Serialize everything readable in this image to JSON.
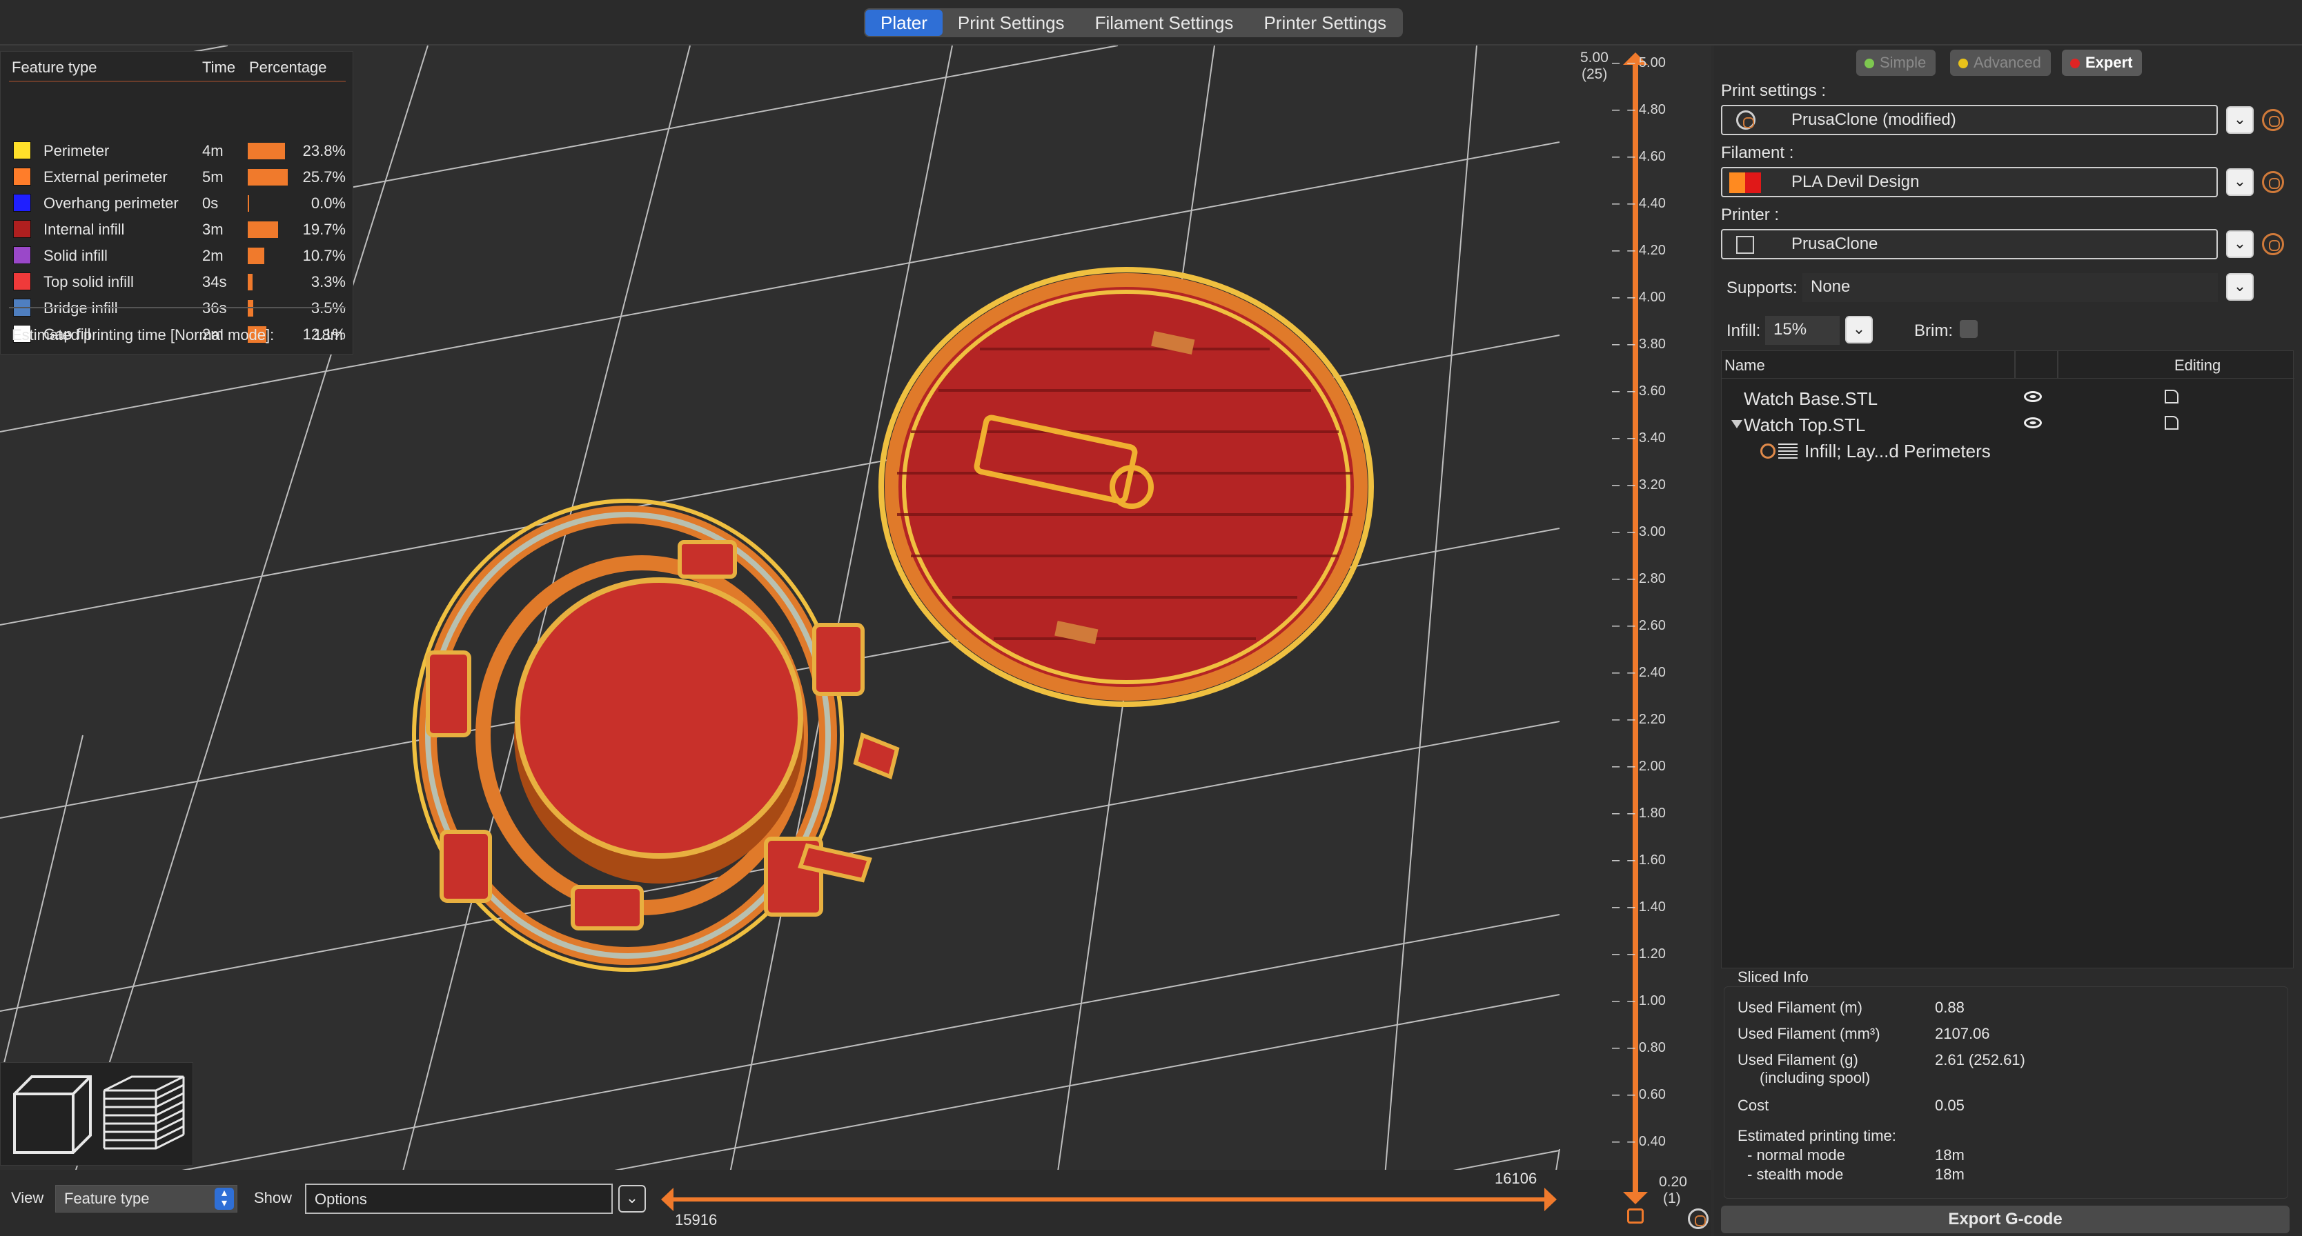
{
  "tabs": [
    "Plater",
    "Print Settings",
    "Filament Settings",
    "Printer Settings"
  ],
  "legend": {
    "headers": {
      "feature": "Feature type",
      "time": "Time",
      "percentage": "Percentage"
    },
    "rows": [
      {
        "name": "Perimeter",
        "time": "4m",
        "pct": "23.8%",
        "value": 23.8,
        "color": "#ffe02a"
      },
      {
        "name": "External perimeter",
        "time": "5m",
        "pct": "25.7%",
        "value": 25.7,
        "color": "#ff7d2a"
      },
      {
        "name": "Overhang perimeter",
        "time": "0s",
        "pct": "0.0%",
        "value": 0.0,
        "color": "#1f1fff"
      },
      {
        "name": "Internal infill",
        "time": "3m",
        "pct": "19.7%",
        "value": 19.7,
        "color": "#b01f1f"
      },
      {
        "name": "Solid infill",
        "time": "2m",
        "pct": "10.7%",
        "value": 10.7,
        "color": "#9a48c9"
      },
      {
        "name": "Top solid infill",
        "time": "34s",
        "pct": "3.3%",
        "value": 3.3,
        "color": "#f03a3a"
      },
      {
        "name": "Bridge infill",
        "time": "36s",
        "pct": "3.5%",
        "value": 3.5,
        "color": "#4f7fc0"
      },
      {
        "name": "Gap fill",
        "time": "2m",
        "pct": "12.1%",
        "value": 12.1,
        "color": "#ffffff"
      }
    ],
    "estimated_label": "Estimated printing time [Normal mode]:",
    "estimated_value": "18m"
  },
  "bottom": {
    "view_label": "View",
    "view_value": "Feature type",
    "show_label": "Show",
    "show_value": "Options",
    "hslider_left": "15916",
    "hslider_right": "16106"
  },
  "vslider": {
    "top_value": "5.00",
    "top_layer": "(25)",
    "bottom_value": "0.20",
    "bottom_layer": "(1)",
    "ticks": [
      "5.00",
      "4.80",
      "4.60",
      "4.40",
      "4.20",
      "4.00",
      "3.80",
      "3.60",
      "3.40",
      "3.20",
      "3.00",
      "2.80",
      "2.60",
      "2.40",
      "2.20",
      "2.00",
      "1.80",
      "1.60",
      "1.40",
      "1.20",
      "1.00",
      "0.80",
      "0.60",
      "0.40"
    ]
  },
  "panel": {
    "modes": [
      {
        "label": "Simple",
        "color": "#7ec850"
      },
      {
        "label": "Advanced",
        "color": "#e8c21a"
      },
      {
        "label": "Expert",
        "color": "#e02424"
      }
    ],
    "print_settings_label": "Print settings :",
    "print_settings_value": "PrusaClone (modified)",
    "filament_label": "Filament :",
    "filament_value": "PLA Devil Design",
    "printer_label": "Printer :",
    "printer_value": "PrusaClone",
    "supports_label": "Supports:",
    "supports_value": "None",
    "infill_label": "Infill:",
    "infill_value": "15%",
    "brim_label": "Brim:",
    "objects": {
      "col_name": "Name",
      "col_editing": "Editing",
      "items": [
        "Watch Base.STL",
        "Watch Top.STL"
      ],
      "sub_item": "Infill; Lay...d Perimeters"
    },
    "sliced": {
      "title": "Sliced Info",
      "rows": [
        {
          "label": "Used Filament (m)",
          "value": "0.88"
        },
        {
          "label": "Used Filament (mm³)",
          "value": "2107.06"
        },
        {
          "label": "Used Filament (g)",
          "value": "2.61 (252.61)"
        },
        {
          "label": "(including spool)",
          "value": ""
        },
        {
          "label": "Cost",
          "value": "0.05"
        },
        {
          "label": "Estimated printing time:",
          "value": ""
        },
        {
          "label": "- normal mode",
          "value": "18m"
        },
        {
          "label": "- stealth mode",
          "value": "18m"
        }
      ]
    },
    "export_label": "Export G-code"
  }
}
